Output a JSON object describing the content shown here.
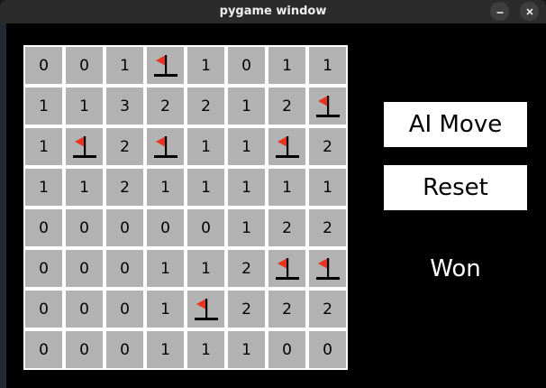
{
  "window": {
    "title": "pygame window",
    "minimize_icon": "minimize-icon",
    "close_icon": "close-icon"
  },
  "board": {
    "rows": 8,
    "cols": 8,
    "cells": [
      [
        "0",
        "0",
        "1",
        "F",
        "1",
        "0",
        "1",
        "1"
      ],
      [
        "1",
        "1",
        "3",
        "2",
        "2",
        "1",
        "2",
        "F"
      ],
      [
        "1",
        "F",
        "2",
        "F",
        "1",
        "1",
        "F",
        "2"
      ],
      [
        "1",
        "1",
        "2",
        "1",
        "1",
        "1",
        "1",
        "1"
      ],
      [
        "0",
        "0",
        "0",
        "0",
        "0",
        "1",
        "2",
        "2"
      ],
      [
        "0",
        "0",
        "0",
        "1",
        "1",
        "2",
        "F",
        "F"
      ],
      [
        "0",
        "0",
        "0",
        "1",
        "F",
        "2",
        "2",
        "2"
      ],
      [
        "0",
        "0",
        "0",
        "1",
        "1",
        "1",
        "0",
        "0"
      ]
    ],
    "flag_icon": "flag-icon",
    "colors": {
      "cell": "#b2b2b2",
      "grid": "#ffffff",
      "flag": "#e8331f",
      "pole": "#000000"
    }
  },
  "controls": {
    "ai_move_label": "AI Move",
    "reset_label": "Reset",
    "status": "Won"
  }
}
